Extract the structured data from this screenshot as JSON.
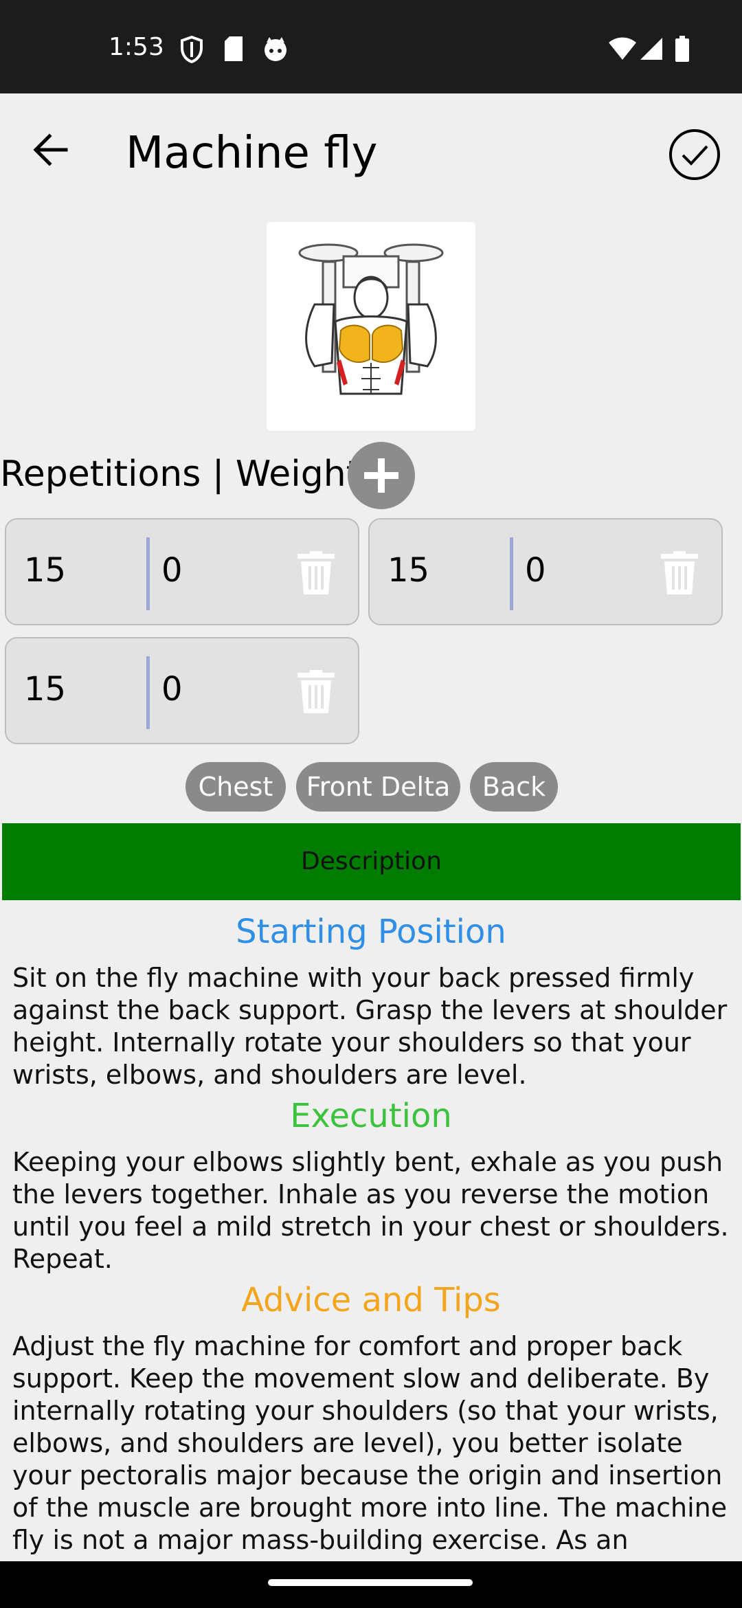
{
  "status_bar": {
    "time": "1:53",
    "icons_left": [
      "shield-icon",
      "sd-card-icon",
      "face-icon"
    ],
    "icons_right": [
      "wifi-icon",
      "signal-icon",
      "battery-icon"
    ]
  },
  "toolbar": {
    "title": "Machine fly",
    "back_icon": "arrow-back-icon",
    "confirm_icon": "check-circle-icon"
  },
  "sets_header": {
    "label": "Repetitions | Weight",
    "add_icon": "plus-icon"
  },
  "sets": [
    {
      "reps": "15",
      "weight": "0"
    },
    {
      "reps": "15",
      "weight": "0"
    },
    {
      "reps": "15",
      "weight": "0"
    }
  ],
  "muscle_tags": [
    "Chest",
    "Front Delta",
    "Back"
  ],
  "description_button": "Description",
  "sections": [
    {
      "title": "Starting Position",
      "color": "#2f8fe6",
      "text": "Sit on the fly machine with your back pressed firmly against the back support. Grasp the levers at shoulder height. Internally rotate your shoulders so that your wrists, elbows, and shoulders are level."
    },
    {
      "title": "Execution",
      "color": "#3cc23c",
      "text": "Keeping your elbows slightly bent, exhale as you push the levers together. Inhale as you reverse the motion until you feel a mild stretch in your chest or shoulders. Repeat."
    },
    {
      "title": "Advice and Tips",
      "color": "#f4a51c",
      "text": "Adjust the fly machine for comfort and proper back support. Keep the movement slow and deliberate. By internally rotating your shoulders (so that your wrists, elbows, and shoulders are level), you better isolate your pectoralis major because the origin and insertion of the muscle are brought more into line. The machine fly is not a major mass-building exercise. As an isolation"
    }
  ],
  "colors": {
    "status_bar": "#1c1c1c",
    "description_bar": "#007d00",
    "tag_bg": "#8a8a8a",
    "card_bg": "#e2e2e2",
    "separator": "#9ea7da"
  }
}
